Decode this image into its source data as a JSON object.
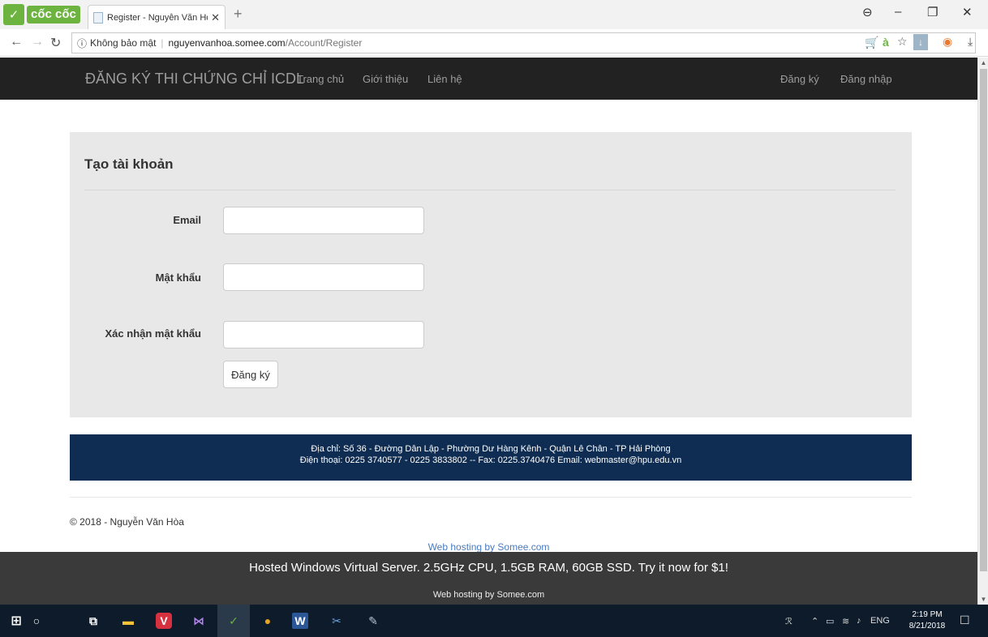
{
  "browser": {
    "brand": "cốc cốc",
    "tab_title": "Register - Nguyễn Văn Hòa",
    "security_label": "Không bảo mật",
    "url_host": "nguyenvanhoa.somee.com",
    "url_path": "/Account/Register"
  },
  "site": {
    "brand": "ĐĂNG KÝ THI CHỨNG CHỈ ICDL",
    "nav_home": "Trang chủ",
    "nav_about": "Giới thiệu",
    "nav_contact": "Liên hệ",
    "nav_register": "Đăng ký",
    "nav_login": "Đăng nhập"
  },
  "form": {
    "title": "Tạo tài khoản",
    "email_label": "Email",
    "email_value": "",
    "password_label": "Mật khẩu",
    "password_value": "",
    "confirm_label": "Xác nhận mật khẩu",
    "confirm_value": "",
    "submit_label": "Đăng ký"
  },
  "footer": {
    "address": "Địa chỉ: Số 36 - Đường Dân Lập - Phường Dư Hàng Kênh - Quận Lê Chân - TP Hải Phòng",
    "contact": "Điện thoại: 0225 3740577 - 0225 3833802 -- Fax: 0225.3740476 Email: webmaster@hpu.edu.vn",
    "copyright": "© 2018 - Nguyễn Văn Hòa"
  },
  "hosting": {
    "link_text": "Web hosting by Somee.com",
    "ad_text": "Hosted Windows Virtual Server. 2.5GHz CPU, 1.5GB RAM, 60GB SSD. Try it now for $1!",
    "sub_text": "Web hosting by Somee.com"
  },
  "taskbar": {
    "lang": "ENG",
    "time": "2:19 PM",
    "date": "8/21/2018"
  },
  "colors": {
    "navbar": "#222222",
    "panel": "#e8e8e8",
    "footer": "#0f2d52",
    "hosting_bar": "#3a3a3a",
    "browser_brand": "#6cb33f"
  }
}
